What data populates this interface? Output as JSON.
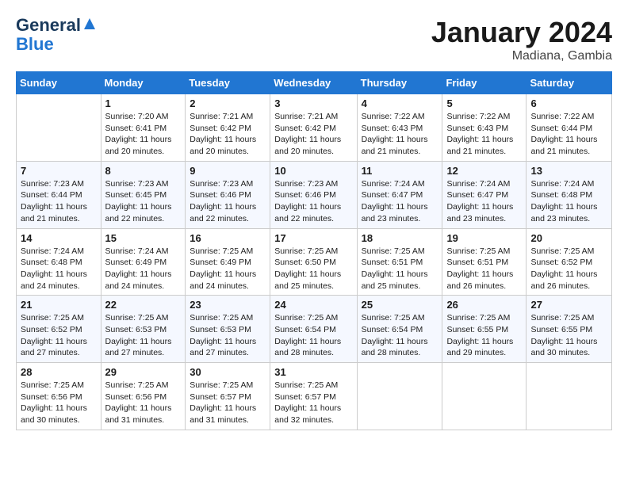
{
  "header": {
    "logo_line1": "General",
    "logo_line2": "Blue",
    "month": "January 2024",
    "location": "Madiana, Gambia"
  },
  "weekdays": [
    "Sunday",
    "Monday",
    "Tuesday",
    "Wednesday",
    "Thursday",
    "Friday",
    "Saturday"
  ],
  "weeks": [
    [
      {
        "day": "",
        "sunrise": "",
        "sunset": "",
        "daylight": ""
      },
      {
        "day": "1",
        "sunrise": "Sunrise: 7:20 AM",
        "sunset": "Sunset: 6:41 PM",
        "daylight": "Daylight: 11 hours and 20 minutes."
      },
      {
        "day": "2",
        "sunrise": "Sunrise: 7:21 AM",
        "sunset": "Sunset: 6:42 PM",
        "daylight": "Daylight: 11 hours and 20 minutes."
      },
      {
        "day": "3",
        "sunrise": "Sunrise: 7:21 AM",
        "sunset": "Sunset: 6:42 PM",
        "daylight": "Daylight: 11 hours and 20 minutes."
      },
      {
        "day": "4",
        "sunrise": "Sunrise: 7:22 AM",
        "sunset": "Sunset: 6:43 PM",
        "daylight": "Daylight: 11 hours and 21 minutes."
      },
      {
        "day": "5",
        "sunrise": "Sunrise: 7:22 AM",
        "sunset": "Sunset: 6:43 PM",
        "daylight": "Daylight: 11 hours and 21 minutes."
      },
      {
        "day": "6",
        "sunrise": "Sunrise: 7:22 AM",
        "sunset": "Sunset: 6:44 PM",
        "daylight": "Daylight: 11 hours and 21 minutes."
      }
    ],
    [
      {
        "day": "7",
        "sunrise": "Sunrise: 7:23 AM",
        "sunset": "Sunset: 6:44 PM",
        "daylight": "Daylight: 11 hours and 21 minutes."
      },
      {
        "day": "8",
        "sunrise": "Sunrise: 7:23 AM",
        "sunset": "Sunset: 6:45 PM",
        "daylight": "Daylight: 11 hours and 22 minutes."
      },
      {
        "day": "9",
        "sunrise": "Sunrise: 7:23 AM",
        "sunset": "Sunset: 6:46 PM",
        "daylight": "Daylight: 11 hours and 22 minutes."
      },
      {
        "day": "10",
        "sunrise": "Sunrise: 7:23 AM",
        "sunset": "Sunset: 6:46 PM",
        "daylight": "Daylight: 11 hours and 22 minutes."
      },
      {
        "day": "11",
        "sunrise": "Sunrise: 7:24 AM",
        "sunset": "Sunset: 6:47 PM",
        "daylight": "Daylight: 11 hours and 23 minutes."
      },
      {
        "day": "12",
        "sunrise": "Sunrise: 7:24 AM",
        "sunset": "Sunset: 6:47 PM",
        "daylight": "Daylight: 11 hours and 23 minutes."
      },
      {
        "day": "13",
        "sunrise": "Sunrise: 7:24 AM",
        "sunset": "Sunset: 6:48 PM",
        "daylight": "Daylight: 11 hours and 23 minutes."
      }
    ],
    [
      {
        "day": "14",
        "sunrise": "Sunrise: 7:24 AM",
        "sunset": "Sunset: 6:48 PM",
        "daylight": "Daylight: 11 hours and 24 minutes."
      },
      {
        "day": "15",
        "sunrise": "Sunrise: 7:24 AM",
        "sunset": "Sunset: 6:49 PM",
        "daylight": "Daylight: 11 hours and 24 minutes."
      },
      {
        "day": "16",
        "sunrise": "Sunrise: 7:25 AM",
        "sunset": "Sunset: 6:49 PM",
        "daylight": "Daylight: 11 hours and 24 minutes."
      },
      {
        "day": "17",
        "sunrise": "Sunrise: 7:25 AM",
        "sunset": "Sunset: 6:50 PM",
        "daylight": "Daylight: 11 hours and 25 minutes."
      },
      {
        "day": "18",
        "sunrise": "Sunrise: 7:25 AM",
        "sunset": "Sunset: 6:51 PM",
        "daylight": "Daylight: 11 hours and 25 minutes."
      },
      {
        "day": "19",
        "sunrise": "Sunrise: 7:25 AM",
        "sunset": "Sunset: 6:51 PM",
        "daylight": "Daylight: 11 hours and 26 minutes."
      },
      {
        "day": "20",
        "sunrise": "Sunrise: 7:25 AM",
        "sunset": "Sunset: 6:52 PM",
        "daylight": "Daylight: 11 hours and 26 minutes."
      }
    ],
    [
      {
        "day": "21",
        "sunrise": "Sunrise: 7:25 AM",
        "sunset": "Sunset: 6:52 PM",
        "daylight": "Daylight: 11 hours and 27 minutes."
      },
      {
        "day": "22",
        "sunrise": "Sunrise: 7:25 AM",
        "sunset": "Sunset: 6:53 PM",
        "daylight": "Daylight: 11 hours and 27 minutes."
      },
      {
        "day": "23",
        "sunrise": "Sunrise: 7:25 AM",
        "sunset": "Sunset: 6:53 PM",
        "daylight": "Daylight: 11 hours and 27 minutes."
      },
      {
        "day": "24",
        "sunrise": "Sunrise: 7:25 AM",
        "sunset": "Sunset: 6:54 PM",
        "daylight": "Daylight: 11 hours and 28 minutes."
      },
      {
        "day": "25",
        "sunrise": "Sunrise: 7:25 AM",
        "sunset": "Sunset: 6:54 PM",
        "daylight": "Daylight: 11 hours and 28 minutes."
      },
      {
        "day": "26",
        "sunrise": "Sunrise: 7:25 AM",
        "sunset": "Sunset: 6:55 PM",
        "daylight": "Daylight: 11 hours and 29 minutes."
      },
      {
        "day": "27",
        "sunrise": "Sunrise: 7:25 AM",
        "sunset": "Sunset: 6:55 PM",
        "daylight": "Daylight: 11 hours and 30 minutes."
      }
    ],
    [
      {
        "day": "28",
        "sunrise": "Sunrise: 7:25 AM",
        "sunset": "Sunset: 6:56 PM",
        "daylight": "Daylight: 11 hours and 30 minutes."
      },
      {
        "day": "29",
        "sunrise": "Sunrise: 7:25 AM",
        "sunset": "Sunset: 6:56 PM",
        "daylight": "Daylight: 11 hours and 31 minutes."
      },
      {
        "day": "30",
        "sunrise": "Sunrise: 7:25 AM",
        "sunset": "Sunset: 6:57 PM",
        "daylight": "Daylight: 11 hours and 31 minutes."
      },
      {
        "day": "31",
        "sunrise": "Sunrise: 7:25 AM",
        "sunset": "Sunset: 6:57 PM",
        "daylight": "Daylight: 11 hours and 32 minutes."
      },
      {
        "day": "",
        "sunrise": "",
        "sunset": "",
        "daylight": ""
      },
      {
        "day": "",
        "sunrise": "",
        "sunset": "",
        "daylight": ""
      },
      {
        "day": "",
        "sunrise": "",
        "sunset": "",
        "daylight": ""
      }
    ]
  ]
}
